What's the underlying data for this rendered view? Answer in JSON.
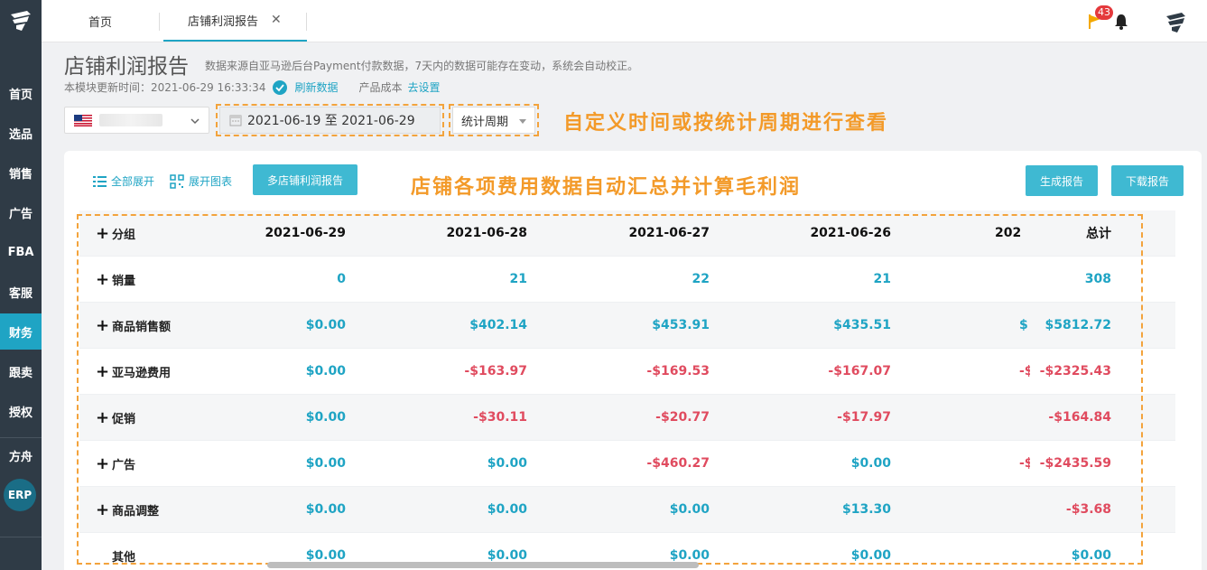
{
  "sidebar": {
    "items": [
      {
        "label": "首页",
        "active": false
      },
      {
        "label": "选品",
        "active": false
      },
      {
        "label": "销售",
        "active": false
      },
      {
        "label": "广告",
        "active": false
      },
      {
        "label": "FBA",
        "active": false
      },
      {
        "label": "客服",
        "active": false
      },
      {
        "label": "财务",
        "active": true
      },
      {
        "label": "跟卖",
        "active": false
      },
      {
        "label": "授权",
        "active": false
      },
      {
        "label": "方舟",
        "active": false
      }
    ],
    "erp_label": "ERP"
  },
  "topbar": {
    "tabs": [
      {
        "label": "首页"
      },
      {
        "label": "店铺利润报告",
        "active": true
      }
    ],
    "close_glyph": "✕",
    "notification_count": "43"
  },
  "header": {
    "title": "店铺利润报告",
    "description": "数据来源自亚马逊后台Payment付款数据，7天内的数据可能存在变动，系统会自动校正。",
    "update_prefix": "本模块更新时间：2021-06-29 16:33:34",
    "refresh_label": "刷新数据",
    "cost_label": "产品成本",
    "cost_link": "去设置"
  },
  "filters": {
    "date_range": "2021-06-19 至 2021-06-29",
    "period_label": "统计周期"
  },
  "annotations": {
    "top": "自定义时间或按统计周期进行查看",
    "middle": "店铺各项费用数据自动汇总并计算毛利润"
  },
  "toolbar": {
    "expand_all": "全部展开",
    "expand_chart": "展开图表",
    "multi_store": "多店铺利润报告",
    "generate": "生成报告",
    "download": "下载报告"
  },
  "table": {
    "group_label": "分组",
    "columns": [
      "2021-06-29",
      "2021-06-28",
      "2021-06-27",
      "2021-06-26",
      "202",
      "总计"
    ],
    "rows": [
      {
        "label": "销量",
        "plus": true,
        "values": [
          "0",
          "21",
          "22",
          "21",
          "",
          "308"
        ],
        "partial": "",
        "tone": "pos"
      },
      {
        "label": "商品销售额",
        "plus": true,
        "values": [
          "$0.00",
          "$402.14",
          "$453.91",
          "$435.51",
          "",
          "$5812.72"
        ],
        "partial": "$",
        "tone": "pos"
      },
      {
        "label": "亚马逊费用",
        "plus": true,
        "values": [
          "$0.00",
          "-$163.97",
          "-$169.53",
          "-$167.07",
          "",
          "-$2325.43"
        ],
        "partial": "-$",
        "tone": "neg"
      },
      {
        "label": "促销",
        "plus": true,
        "values": [
          "$0.00",
          "-$30.11",
          "-$20.77",
          "-$17.97",
          "",
          "-$164.84"
        ],
        "partial": "",
        "tone": "neg"
      },
      {
        "label": "广告",
        "plus": true,
        "values": [
          "$0.00",
          "$0.00",
          "-$460.27",
          "$0.00",
          "",
          "-$2435.59"
        ],
        "partial": "-$",
        "tone": "neg"
      },
      {
        "label": "商品调整",
        "plus": true,
        "values": [
          "$0.00",
          "$0.00",
          "$0.00",
          "$13.30",
          "",
          "-$3.68"
        ],
        "partial": "",
        "tone": "neg"
      },
      {
        "label": "其他",
        "plus": false,
        "values": [
          "$0.00",
          "$0.00",
          "$0.00",
          "$0.00",
          "",
          "$0.00"
        ],
        "partial": "",
        "tone": "pos"
      }
    ]
  },
  "colors": {
    "accent": "#1fa4c4",
    "negative": "#e04b5f",
    "annotation": "#f39a29",
    "sidebar": "#2f3b46"
  }
}
